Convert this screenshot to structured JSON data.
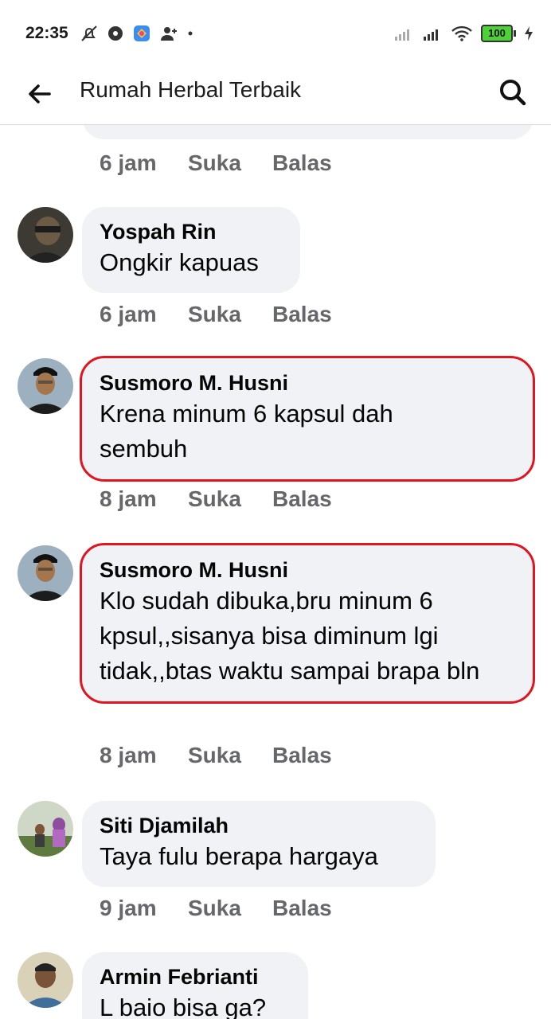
{
  "status_bar": {
    "time": "22:35",
    "battery": "100",
    "icons_left": [
      "mute-icon",
      "record-icon",
      "app-icon",
      "add-user-icon",
      "dot-icon"
    ],
    "icons_right": [
      "signal-icon",
      "signal-icon",
      "wifi-icon",
      "battery-icon",
      "charging-icon"
    ]
  },
  "header": {
    "title": "Rumah Herbal Terbaik",
    "back_icon": "arrow-left-icon",
    "search_icon": "search-icon"
  },
  "actions": {
    "like": "Suka",
    "reply": "Balas"
  },
  "top_partial": {
    "time": "6 jam"
  },
  "comments": [
    {
      "author": "Yospah Rin",
      "text": "Ongkir kapuas",
      "time": "6 jam",
      "highlighted": false
    },
    {
      "author": "Susmoro M. Husni",
      "text": "Krena minum 6 kapsul dah sembuh",
      "time": "8 jam",
      "highlighted": true
    },
    {
      "author": "Susmoro M. Husni",
      "text": "Klo sudah dibuka,bru minum 6 kpsul,,sisanya bisa diminum lgi tidak,,btas waktu sampai brapa bln",
      "time": "8 jam",
      "highlighted": true
    },
    {
      "author": "Siti Djamilah",
      "text": "Taya fulu berapa hargaya",
      "time": "9 jam",
      "highlighted": false
    },
    {
      "author": "Armin Febrianti",
      "text": "L baio bisa ga?",
      "time": "",
      "highlighted": false
    }
  ],
  "colors": {
    "highlight_border": "#e0151f",
    "bubble_bg": "#f0f2f5",
    "meta_text": "#65676b"
  }
}
